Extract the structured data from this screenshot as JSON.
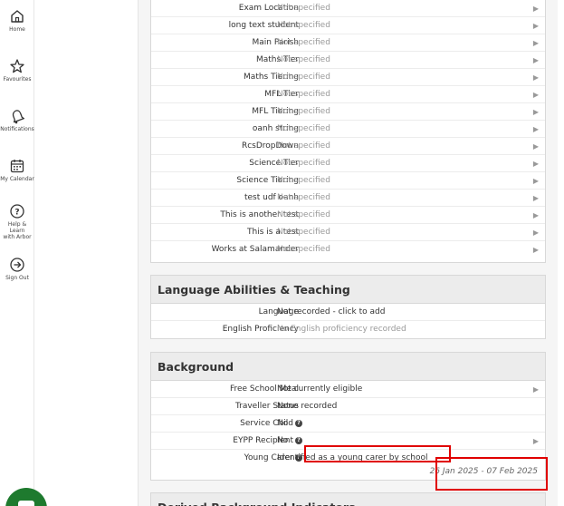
{
  "sidebar": {
    "items": [
      {
        "label": "Home",
        "icon": "home-icon"
      },
      {
        "label": "Favourites",
        "icon": "star-icon"
      },
      {
        "label": "Notifications",
        "icon": "bell-icon"
      },
      {
        "label": "My Calendar",
        "icon": "calendar-icon"
      },
      {
        "label_line1": "Help & Learn",
        "label_line2": "with Arbor",
        "icon": "help-icon"
      },
      {
        "label": "Sign Out",
        "icon": "sign-out-icon"
      }
    ]
  },
  "udf_section": {
    "rows": [
      {
        "label": "Exam Location",
        "value": "Not specified"
      },
      {
        "label": "long text student",
        "value": "Not specified"
      },
      {
        "label": "Main Parish",
        "value": "Not specified"
      },
      {
        "label": "Maths Tier",
        "value": "Not specified"
      },
      {
        "label": "Maths Tiering",
        "value": "Not specified"
      },
      {
        "label": "MFL Tier",
        "value": "Not specified"
      },
      {
        "label": "MFL Tiering",
        "value": "Not specified"
      },
      {
        "label": "oanh string",
        "value": "Not specified"
      },
      {
        "label": "RcsDropDown",
        "value": "Not specified"
      },
      {
        "label": "Science Tier",
        "value": "Not specified"
      },
      {
        "label": "Science Tiering",
        "value": "Not specified"
      },
      {
        "label": "test udf oanh",
        "value": "Not specified"
      },
      {
        "label": "This is another test",
        "value": "Not specified"
      },
      {
        "label": "This is a test",
        "value": "Not specified"
      },
      {
        "label": "Works at Salamander",
        "value": "Not specified"
      }
    ]
  },
  "language_section": {
    "title": "Language Abilities & Teaching",
    "rows": [
      {
        "label": "Language",
        "value": "Not recorded - click to add"
      },
      {
        "label": "English Proficiency",
        "value": "No English proficiency recorded"
      }
    ]
  },
  "background_section": {
    "title": "Background",
    "rows": [
      {
        "label": "Free School Meal",
        "value": "Not currently eligible"
      },
      {
        "label": "Traveller Status",
        "value": "None recorded"
      },
      {
        "label": "Service Child",
        "value": "No"
      },
      {
        "label": "EYPP Recipient",
        "value": "No"
      },
      {
        "label": "Young Carer",
        "value": "Identified as a young carer by school",
        "date_range": "26 Jan 2025 - 07 Feb 2025"
      }
    ]
  },
  "derived_section": {
    "title": "Derived Background Indicators"
  },
  "colors": {
    "highlight": "#e00000",
    "fab": "#1e7a2e",
    "section_header": "#ececec"
  }
}
